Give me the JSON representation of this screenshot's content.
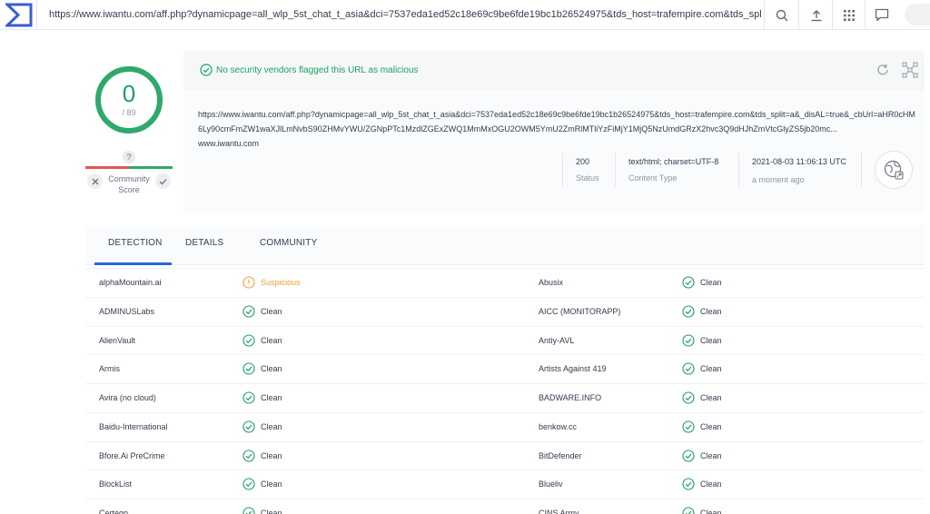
{
  "toolbar": {
    "url": "https://www.iwantu.com/aff.php?dynamicpage=all_wlp_5st_chat_t_asia&dci=7537eda1ed52c18e69c9be6fde19bc1b26524975&tds_host=trafempire.com&tds_split=a&_dis",
    "icons": [
      "search-icon",
      "upload-icon",
      "apps-grid-icon",
      "chat-icon"
    ]
  },
  "score": {
    "detections": "0",
    "total": "/ 89",
    "community_unknown": "?",
    "community_label": "Community Score"
  },
  "summary": {
    "banner": "No security vendors flagged this URL as malicious",
    "full_url": "https://www.iwantu.com/aff.php?dynamicpage=all_wlp_5st_chat_t_asia&dci=7537eda1ed52c18e69c9be6fde19bc1b26524975&tds_host=trafempire.com&tds_split=a&_disAL=true&_cbUrl=aHR0cHM6Ly90cmFmZW1waXJlLmNvbS90ZHMvYWU/ZGNpPTc1MzdlZGExZWQ1MmMxOGU2OWM5YmU2ZmRlMTliYzFiMjY1MjQ5NzUmdGRzX2hvc3Q9dHJhZmVtcGlyZS5jb20mc...",
    "domain": "www.iwantu.com",
    "status_value": "200",
    "status_label": "Status",
    "content_type_value": "text/html; charset=UTF-8",
    "content_type_label": "Content Type",
    "date_value": "2021-08-03 11:06:13 UTC",
    "date_label": "a moment ago"
  },
  "tabs": {
    "detection": "DETECTION",
    "details": "DETAILS",
    "community": "COMMUNITY"
  },
  "colors": {
    "clean": "#1e9e62",
    "suspicious": "#e9a23b",
    "tab_active": "#2c66dd"
  },
  "results": [
    {
      "left_engine": "alphaMountain.ai",
      "left_verdict": "Suspicious",
      "right_engine": "Abusix",
      "right_verdict": "Clean"
    },
    {
      "left_engine": "ADMINUSLabs",
      "left_verdict": "Clean",
      "right_engine": "AICC (MONITORAPP)",
      "right_verdict": "Clean"
    },
    {
      "left_engine": "AlienVault",
      "left_verdict": "Clean",
      "right_engine": "Antiy-AVL",
      "right_verdict": "Clean"
    },
    {
      "left_engine": "Armis",
      "left_verdict": "Clean",
      "right_engine": "Artists Against 419",
      "right_verdict": "Clean"
    },
    {
      "left_engine": "Avira (no cloud)",
      "left_verdict": "Clean",
      "right_engine": "BADWARE.INFO",
      "right_verdict": "Clean"
    },
    {
      "left_engine": "Baidu-International",
      "left_verdict": "Clean",
      "right_engine": "benkow.cc",
      "right_verdict": "Clean"
    },
    {
      "left_engine": "Bfore.Ai PreCrime",
      "left_verdict": "Clean",
      "right_engine": "BitDefender",
      "right_verdict": "Clean"
    },
    {
      "left_engine": "BlockList",
      "left_verdict": "Clean",
      "right_engine": "Blueliv",
      "right_verdict": "Clean"
    },
    {
      "left_engine": "Certego",
      "left_verdict": "Clean",
      "right_engine": "CINS Army",
      "right_verdict": "Clean"
    }
  ]
}
